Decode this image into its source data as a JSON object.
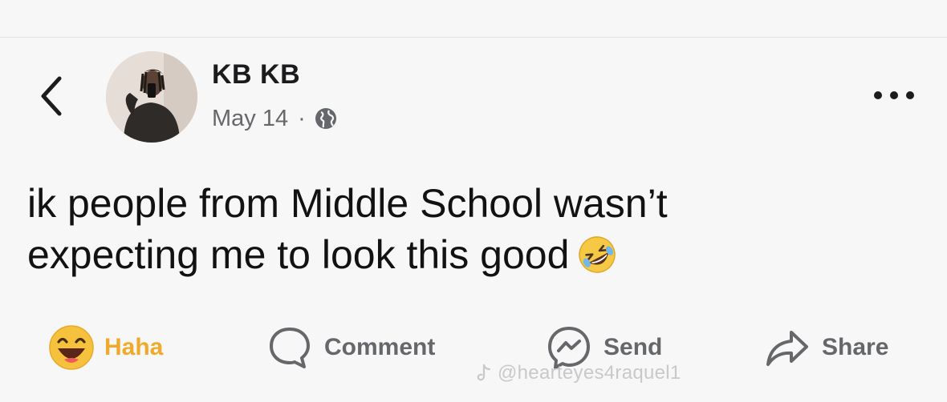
{
  "header": {
    "back_icon": "chevron-left-icon",
    "more_icon": "ellipsis-icon"
  },
  "author": {
    "name": "KB KB",
    "date": "May 14",
    "separator": "·",
    "audience_icon": "globe-icon"
  },
  "post": {
    "text_line_1": "ik people from Middle School wasn’t",
    "text_line_2": "expecting me to look this good",
    "emoji": "rolling-on-floor-laughing-emoji"
  },
  "actions": {
    "haha_label": "Haha",
    "comment_label": "Comment",
    "send_label": "Send",
    "share_label": "Share"
  },
  "watermark": {
    "text": "@hearteyes4raquel1",
    "icon": "tiktok-icon"
  },
  "colors": {
    "background": "#f7f7f7",
    "text": "#121212",
    "muted": "#65676b",
    "haha": "#f0a92b"
  }
}
